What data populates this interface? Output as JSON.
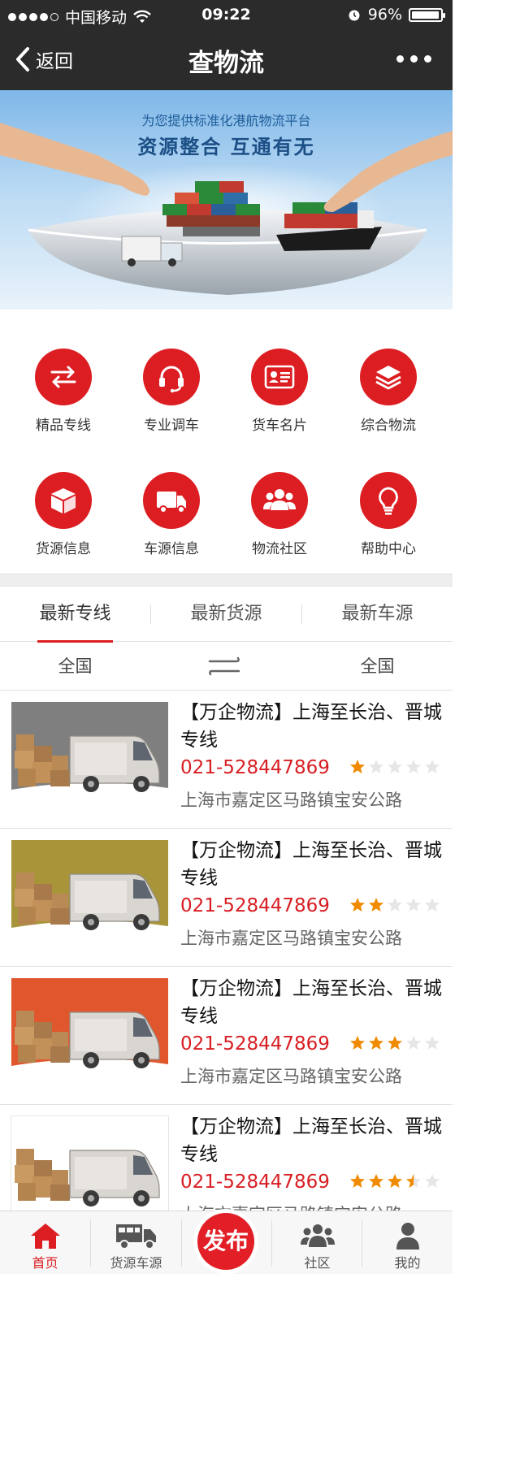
{
  "status_bar": {
    "carrier": "中国移动",
    "time": "09:22",
    "battery": "96%",
    "battery_level": 0.96
  },
  "nav": {
    "back_label": "返回",
    "title": "查物流"
  },
  "banner": {
    "tagline": "为您提供标准化港航物流平台",
    "slogan": "资源整合 互通有无"
  },
  "grid": [
    {
      "label": "精品专线",
      "icon": "swap-arrows-icon"
    },
    {
      "label": "专业调车",
      "icon": "headset-icon"
    },
    {
      "label": "货车名片",
      "icon": "id-card-icon"
    },
    {
      "label": "综合物流",
      "icon": "layers-icon"
    },
    {
      "label": "货源信息",
      "icon": "package-icon"
    },
    {
      "label": "车源信息",
      "icon": "truck-icon"
    },
    {
      "label": "物流社区",
      "icon": "people-icon"
    },
    {
      "label": "帮助中心",
      "icon": "lightbulb-icon"
    }
  ],
  "tabs": [
    "最新专线",
    "最新货源",
    "最新车源"
  ],
  "active_tab": 0,
  "filter": {
    "from": "全国",
    "to": "全国"
  },
  "list": [
    {
      "title": "【万企物流】上海至长治、晋城专线",
      "phone": "021-528447869",
      "rating": 1,
      "address": "上海市嘉定区马路镇宝安公路",
      "bg": "#7f7f7f"
    },
    {
      "title": "【万企物流】上海至长治、晋城专线",
      "phone": "021-528447869",
      "rating": 2,
      "address": "上海市嘉定区马路镇宝安公路",
      "bg": "#a8953a"
    },
    {
      "title": "【万企物流】上海至长治、晋城专线",
      "phone": "021-528447869",
      "rating": 3,
      "address": "上海市嘉定区马路镇宝安公路",
      "bg": "#e0572e"
    },
    {
      "title": "【万企物流】上海至长治、晋城专线",
      "phone": "021-528447869",
      "rating": 3.5,
      "address": "上海市嘉定区马路镇宝安公路",
      "bg": "#ffffff"
    }
  ],
  "tabbar": {
    "home": "首页",
    "cargo": "货源车源",
    "publish": "发布",
    "community": "社区",
    "mine": "我的"
  },
  "colors": {
    "brand_red": "#dc1e23",
    "star_orange": "#f08a00",
    "star_empty": "#e6e6e6",
    "nav_dark": "#2b2b2b"
  }
}
